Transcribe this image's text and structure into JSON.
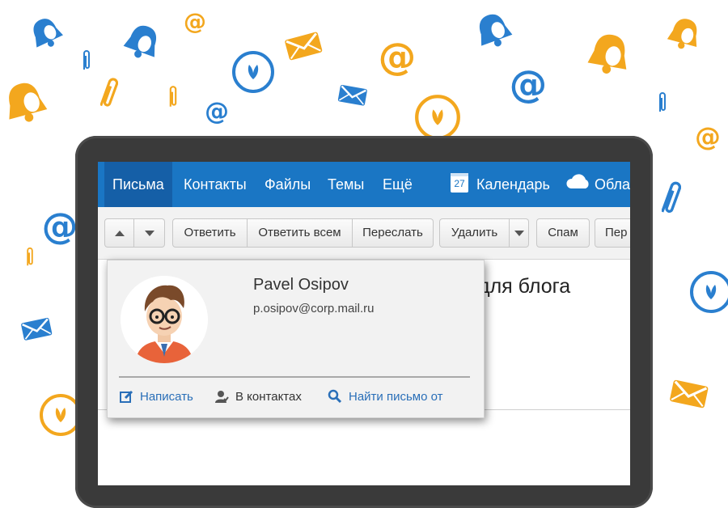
{
  "nav": {
    "items": [
      "Письма",
      "Контакты",
      "Файлы",
      "Темы",
      "Ещё"
    ],
    "calendar_day": "27",
    "calendar_label": "Календарь",
    "cloud_label": "Обла"
  },
  "toolbar": {
    "reply": "Ответить",
    "reply_all": "Ответить всем",
    "forward": "Переслать",
    "delete": "Удалить",
    "spam": "Спам",
    "more_cut": "Пер"
  },
  "message": {
    "subject_fragment": "для блога"
  },
  "contact_card": {
    "name": "Pavel Osipov",
    "email": "p.osipov@corp.mail.ru",
    "actions": {
      "write": "Написать",
      "in_contacts": "В контактах",
      "find_mail": "Найти письмо от"
    }
  },
  "colors": {
    "nav_blue": "#1a76c4",
    "nav_active": "#155fa7",
    "deco_blue": "#2a7fcf",
    "deco_orange": "#f3a71e",
    "link_blue": "#2a6fb8"
  }
}
